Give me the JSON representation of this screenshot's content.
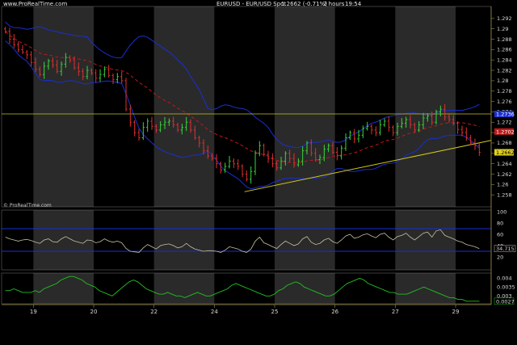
{
  "header": {
    "site": "www.ProRealTime.com",
    "symbol": "EURUSD - EUR/USD Spot",
    "last": "1.2662 (-0.71%)",
    "timeframe": "2 hours",
    "time": "19:54",
    "watermark": "© ProRealTime.com"
  },
  "colors": {
    "background": "#000000",
    "shade": "#2a2a2a",
    "candle_up": "#38d638",
    "candle_down": "#e03030",
    "bollinger": "#1a2fd0",
    "moving_average": "#c01818",
    "horizontal_line": "#c8c020",
    "trendline": "#d4c818",
    "rsi_line": "#c8c0a0",
    "osc_line": "#20c020",
    "axis": "#9a8a40"
  },
  "chart_data": [
    {
      "type": "candlestick",
      "panel": "price",
      "title": "EURUSD - EUR/USD Spot",
      "ylim": [
        1.256,
        1.294
      ],
      "y_ticks": [
        "1.292",
        "1.29",
        "1.288",
        "1.286",
        "1.284",
        "1.282",
        "1.28",
        "1.278",
        "1.276",
        "1.274",
        "1.272",
        "1.27",
        "1.268",
        "1.266",
        "1.264",
        "1.262",
        "1.26",
        "1.258"
      ],
      "last_price_label": "1.2662",
      "markers": [
        {
          "label": "1.2736",
          "value": 1.2736,
          "color": "#1a2fd0"
        },
        {
          "label": "1.2702",
          "value": 1.2702,
          "color": "#c01818"
        }
      ],
      "horizontal_line": 1.2736,
      "trendline": [
        [
          24.5,
          1.2586
        ],
        [
          30.3,
          1.2685
        ]
      ],
      "closes": [
        1.2895,
        1.288,
        1.287,
        1.286,
        1.2855,
        1.285,
        1.2835,
        1.2822,
        1.2812,
        1.2828,
        1.2838,
        1.283,
        1.2818,
        1.2832,
        1.2845,
        1.284,
        1.2825,
        1.2818,
        1.2808,
        1.282,
        1.2815,
        1.2805,
        1.2812,
        1.2822,
        1.281,
        1.2802,
        1.2808,
        1.28,
        1.2745,
        1.272,
        1.27,
        1.269,
        1.271,
        1.2722,
        1.2712,
        1.2705,
        1.2715,
        1.272,
        1.2722,
        1.2715,
        1.2705,
        1.271,
        1.272,
        1.2705,
        1.269,
        1.268,
        1.2665,
        1.2655,
        1.265,
        1.264,
        1.2628,
        1.2635,
        1.2645,
        1.264,
        1.2635,
        1.262,
        1.261,
        1.2625,
        1.266,
        1.2675,
        1.2658,
        1.265,
        1.264,
        1.2632,
        1.2645,
        1.266,
        1.265,
        1.2638,
        1.2645,
        1.2665,
        1.268,
        1.266,
        1.2648,
        1.2652,
        1.2668,
        1.2675,
        1.2662,
        1.2655,
        1.267,
        1.269,
        1.27,
        1.2688,
        1.2695,
        1.2708,
        1.2712,
        1.2705,
        1.27,
        1.2715,
        1.2722,
        1.271,
        1.27,
        1.2712,
        1.2718,
        1.2725,
        1.2715,
        1.2705,
        1.2715,
        1.2728,
        1.2732,
        1.272,
        1.274,
        1.2745,
        1.273,
        1.2725,
        1.2718,
        1.2706,
        1.27,
        1.269,
        1.268,
        1.2675,
        1.2662
      ],
      "x_ticks": [
        "19",
        "20",
        "22",
        "24",
        "25",
        "26",
        "27",
        "29"
      ],
      "x_tick_bars": [
        7,
        21,
        35,
        49,
        63,
        77,
        91,
        105
      ]
    },
    {
      "type": "line",
      "panel": "rsi",
      "ylim": [
        0,
        100
      ],
      "y_ticks": [
        "100",
        "80",
        "60",
        "40",
        "20"
      ],
      "levels": [
        70,
        30
      ],
      "last_label": "34.715",
      "values": [
        55,
        52,
        50,
        48,
        50,
        51,
        49,
        46,
        44,
        50,
        52,
        47,
        46,
        52,
        56,
        52,
        48,
        46,
        44,
        50,
        49,
        45,
        47,
        52,
        48,
        46,
        48,
        45,
        35,
        30,
        29,
        28,
        36,
        42,
        38,
        34,
        40,
        42,
        43,
        40,
        36,
        38,
        44,
        38,
        34,
        32,
        30,
        31,
        31,
        30,
        28,
        32,
        38,
        36,
        34,
        30,
        28,
        34,
        48,
        55,
        45,
        42,
        38,
        35,
        42,
        48,
        44,
        40,
        43,
        52,
        56,
        46,
        42,
        44,
        50,
        53,
        47,
        44,
        50,
        57,
        60,
        53,
        55,
        59,
        61,
        57,
        54,
        60,
        62,
        55,
        50,
        56,
        58,
        62,
        55,
        50,
        56,
        62,
        64,
        55,
        66,
        68,
        58,
        55,
        52,
        48,
        46,
        42,
        40,
        38,
        34.7
      ]
    },
    {
      "type": "line",
      "panel": "oscillator",
      "ylim": [
        0.0026,
        0.0042
      ],
      "y_ticks": [
        "0.004",
        "0.0035",
        "0.003"
      ],
      "last_label": "0.0027",
      "values": [
        0.0033,
        0.0033,
        0.0034,
        0.0033,
        0.0032,
        0.0032,
        0.0032,
        0.0033,
        0.0032,
        0.0034,
        0.0035,
        0.0036,
        0.0037,
        0.0039,
        0.004,
        0.0041,
        0.0041,
        0.004,
        0.0039,
        0.0037,
        0.0036,
        0.0035,
        0.0033,
        0.0032,
        0.0031,
        0.003,
        0.0032,
        0.0034,
        0.0036,
        0.0038,
        0.0039,
        0.0038,
        0.0036,
        0.0034,
        0.0033,
        0.0032,
        0.0031,
        0.0031,
        0.0032,
        0.0031,
        0.003,
        0.003,
        0.0029,
        0.003,
        0.0031,
        0.0032,
        0.0031,
        0.003,
        0.003,
        0.0031,
        0.0032,
        0.0033,
        0.0034,
        0.0036,
        0.0037,
        0.0036,
        0.0035,
        0.0034,
        0.0033,
        0.0032,
        0.0031,
        0.003,
        0.003,
        0.0031,
        0.0033,
        0.0034,
        0.0036,
        0.0037,
        0.0038,
        0.0037,
        0.0035,
        0.0034,
        0.0033,
        0.0032,
        0.0031,
        0.003,
        0.003,
        0.0031,
        0.0033,
        0.0035,
        0.0037,
        0.0038,
        0.0039,
        0.004,
        0.0039,
        0.0037,
        0.0036,
        0.0035,
        0.0034,
        0.0033,
        0.0032,
        0.0032,
        0.0031,
        0.0031,
        0.0031,
        0.0032,
        0.0033,
        0.0034,
        0.0035,
        0.0034,
        0.0033,
        0.0032,
        0.0031,
        0.003,
        0.0029,
        0.0029,
        0.0028,
        0.0028,
        0.0027,
        0.0027,
        0.0027,
        0.0027
      ]
    }
  ]
}
